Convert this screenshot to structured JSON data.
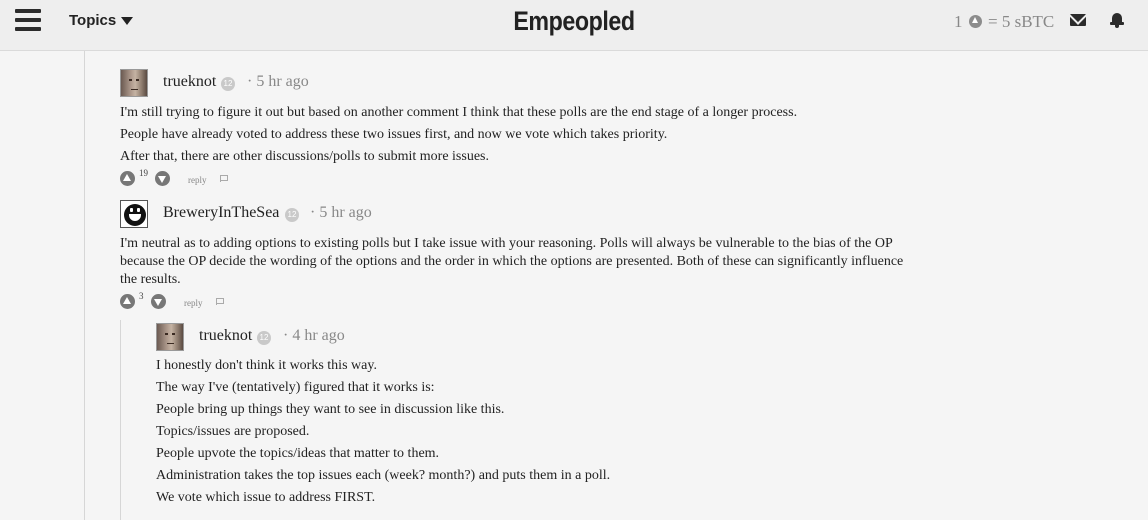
{
  "header": {
    "topics_label": "Topics",
    "brand": "Empeopled",
    "rate_left": "1",
    "rate_right": "= 5 sBTC"
  },
  "comments": [
    {
      "author": "trueknot",
      "level": "12",
      "time": "· 5 hr ago",
      "lines": [
        "I'm still trying to figure it out but based on another comment I think that these polls are the end stage of a longer process.",
        "People have already voted to address these two issues first, and now we vote which takes priority.",
        "After that, there are other discussions/polls to submit more issues."
      ],
      "score": "19",
      "reply_label": "reply"
    },
    {
      "author": "BreweryInTheSea",
      "level": "12",
      "time": "· 5 hr ago",
      "text": "I'm neutral as to adding options to existing polls but I take issue with your reasoning. Polls will always be vulnerable to the bias of the OP because the OP decide the wording of the options and the order in which the options are presented. Both of these can significantly influence the results.",
      "score": "3",
      "reply_label": "reply"
    },
    {
      "author": "trueknot",
      "level": "12",
      "time": "· 4 hr ago",
      "lines": [
        "I honestly don't think it works this way.",
        "The way I've (tentatively) figured that it works is:",
        "People bring up things they want to see in discussion like this.",
        "Topics/issues are proposed.",
        "People upvote the topics/ideas that matter to them.",
        "Administration takes the top issues each (week? month?) and puts them in a poll.",
        "We vote which issue to address FIRST."
      ]
    }
  ],
  "ghost_reply": "reply"
}
